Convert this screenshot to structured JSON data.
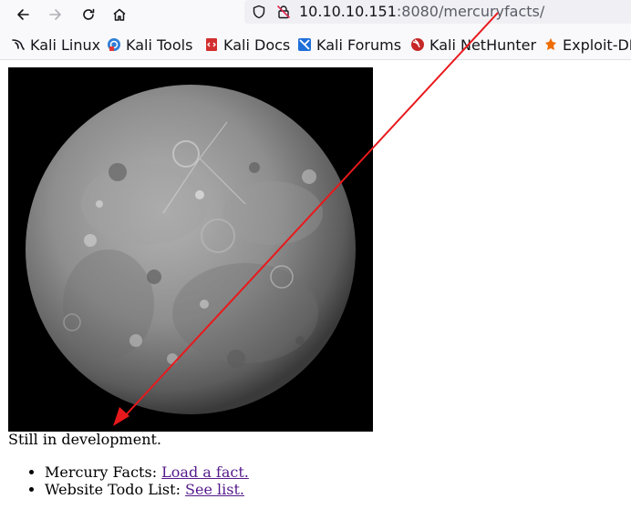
{
  "browser": {
    "url_host": "10.10.10.151",
    "url_rest": ":8080/mercuryfacts/",
    "nav_icons": [
      "back-icon",
      "forward-icon",
      "reload-icon",
      "home-icon"
    ],
    "url_icons": [
      "shield-icon",
      "insecure-lock-icon"
    ]
  },
  "bookmarks": [
    {
      "label": "Kali Linux",
      "icon": "kali-dragon-icon"
    },
    {
      "label": "Kali Tools",
      "icon": "kali-tools-icon"
    },
    {
      "label": "Kali Docs",
      "icon": "kali-docs-icon"
    },
    {
      "label": "Kali Forums",
      "icon": "kali-forums-icon"
    },
    {
      "label": "Kali NetHunter",
      "icon": "kali-nethunter-icon"
    },
    {
      "label": "Exploit-DB",
      "icon": "exploit-db-icon"
    }
  ],
  "page": {
    "image": "mercury-planet-image",
    "status_text": "Still in development.",
    "items": [
      {
        "prefix": "Mercury Facts: ",
        "link": "Load a fact."
      },
      {
        "prefix": "Website Todo List: ",
        "link": "See list."
      }
    ]
  },
  "annotation": {
    "color": "#e8191c",
    "shape": "red-arrow"
  }
}
